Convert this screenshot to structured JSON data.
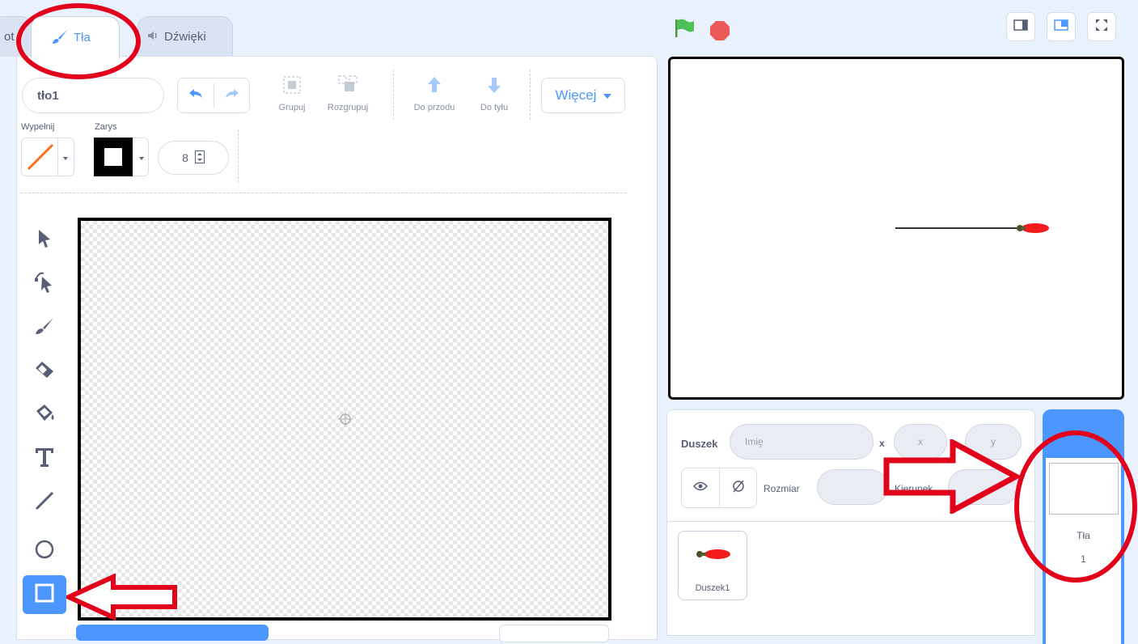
{
  "tabs": [
    {
      "label": "ot",
      "name": "tab-code"
    },
    {
      "label": "Tła",
      "name": "tab-backdrops"
    },
    {
      "label": "Dźwięki",
      "name": "tab-sounds"
    }
  ],
  "editor": {
    "costume_name": "tło1",
    "group_label": "Grupuj",
    "ungroup_label": "Rozgrupuj",
    "forward_label": "Do przodu",
    "backward_label": "Do tyłu",
    "more_label": "Więcej",
    "fill_label": "Wypełnij",
    "outline_label": "Zarys",
    "outline_width": "8"
  },
  "sprite_info": {
    "sprite_label": "Duszek",
    "name_placeholder": "Imię",
    "x_label": "x",
    "x_placeholder": "x",
    "y_label": "",
    "y_placeholder": "y",
    "size_label": "Rozmiar",
    "direction_label": "Kierunek"
  },
  "sprites": [
    {
      "name": "Duszek1"
    }
  ],
  "stage_pane": {
    "backdrop_label": "Tła",
    "backdrop_count": "1"
  },
  "colors": {
    "accent": "#4c97ff",
    "annotation": "#e3001b",
    "flag": "#4cbf56",
    "stop": "#ec5959",
    "fill_swatch": "#ff6d19"
  },
  "icons": [
    "brush-icon",
    "speaker-icon",
    "undo-icon",
    "redo-icon",
    "group-icon",
    "ungroup-icon",
    "forward-icon",
    "backward-icon",
    "caret-down-icon",
    "select-icon",
    "reshape-icon",
    "brush-tool-icon",
    "eraser-icon",
    "fill-icon",
    "text-icon",
    "line-icon",
    "circle-icon",
    "rectangle-icon",
    "green-flag-icon",
    "stop-icon",
    "small-stage-icon",
    "normal-stage-icon",
    "fullscreen-icon",
    "eye-icon",
    "hidden-icon"
  ]
}
